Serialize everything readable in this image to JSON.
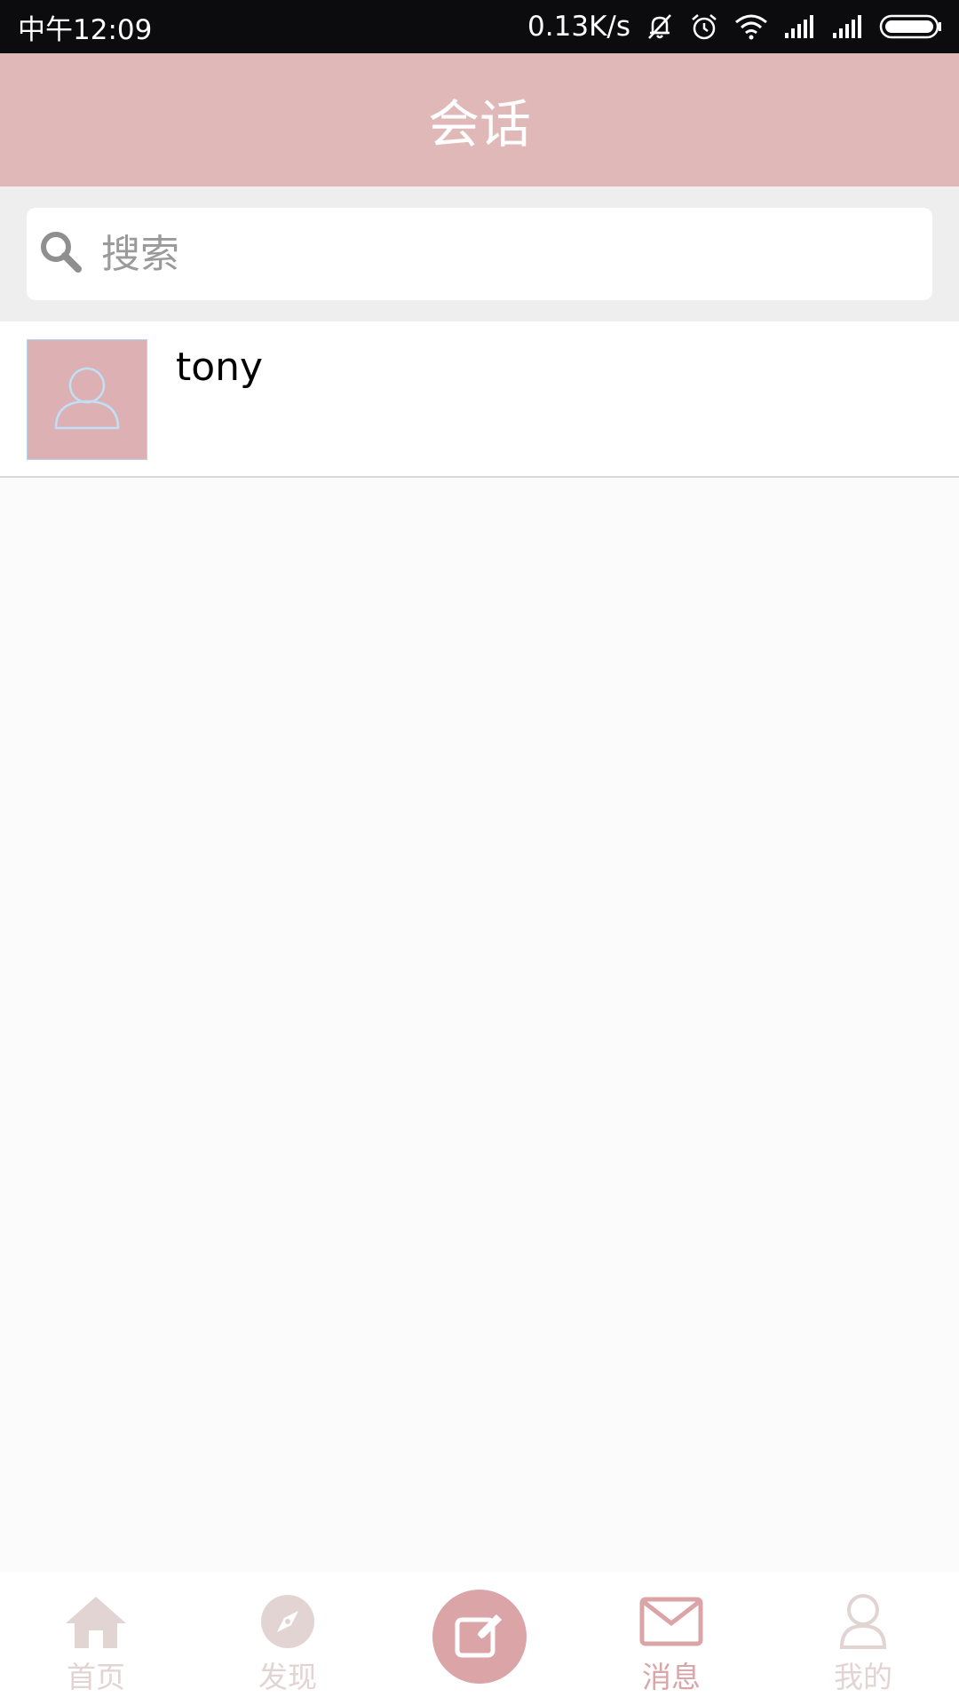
{
  "status_bar": {
    "time": "中午12:09",
    "network_speed": "0.13K/s",
    "icons": [
      "bell-muted-icon",
      "alarm-icon",
      "wifi-icon",
      "signal-icon",
      "signal-icon",
      "battery-icon"
    ]
  },
  "header": {
    "title": "会话"
  },
  "search": {
    "placeholder": "搜索",
    "value": ""
  },
  "conversations": [
    {
      "name": "tony",
      "avatar_icon": "user-icon"
    }
  ],
  "tab_bar": {
    "items": [
      {
        "label": "首页",
        "icon": "home-icon",
        "active": false
      },
      {
        "label": "发现",
        "icon": "compass-icon",
        "active": false
      },
      {
        "label": "",
        "icon": "compose-icon",
        "active": false
      },
      {
        "label": "消息",
        "icon": "mail-icon",
        "active": true
      },
      {
        "label": "我的",
        "icon": "user-icon",
        "active": false
      }
    ]
  },
  "colors": {
    "header_bg": "#e1b8b8",
    "accent": "#dba5a7",
    "inactive_tab": "#e3d4d4",
    "avatar_bg": "#ddb1b3"
  }
}
